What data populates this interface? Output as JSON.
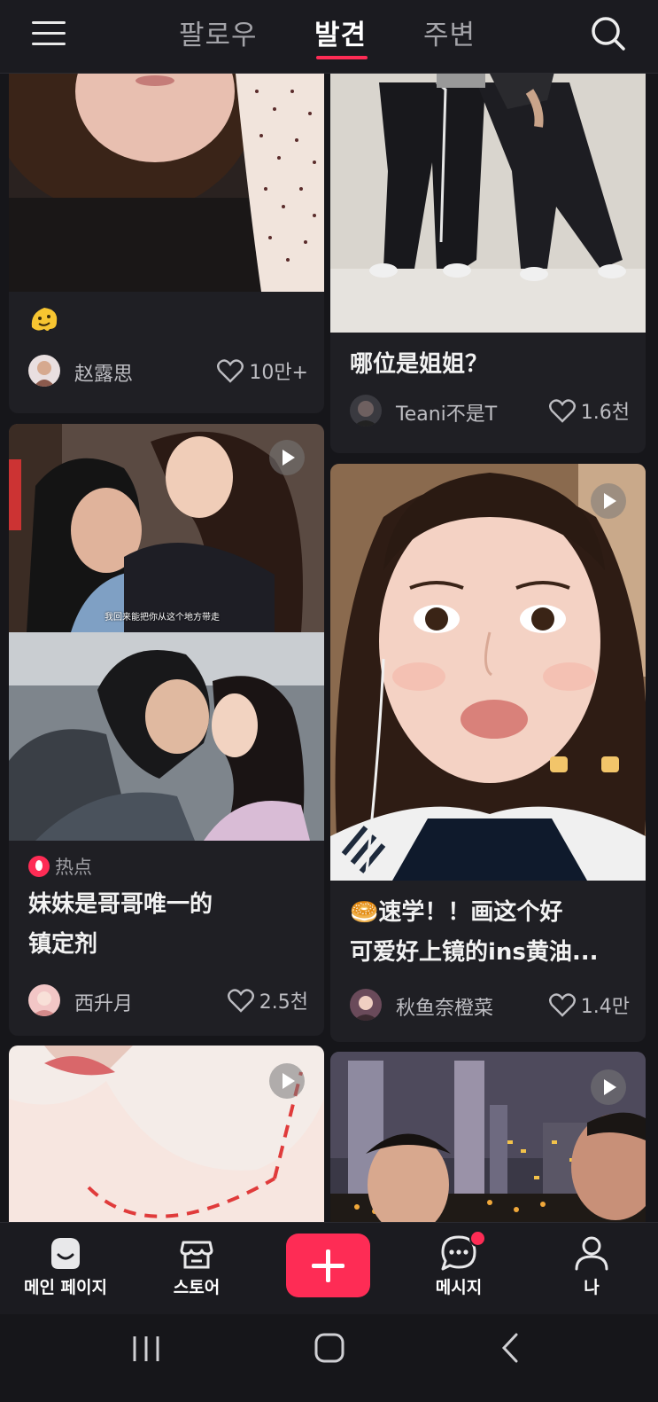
{
  "header": {
    "tabs": [
      {
        "label": "팔로우",
        "active": false
      },
      {
        "label": "발견",
        "active": true
      },
      {
        "label": "주변",
        "active": false
      }
    ],
    "accent_color": "#fe2c55"
  },
  "feed": {
    "cards": [
      {
        "id": "card-1",
        "title_emoji": "🫠",
        "author": "赵露思",
        "likes": "10만+",
        "has_video": false
      },
      {
        "id": "card-2",
        "title": "哪位是姐姐？",
        "author": "Teani不是T",
        "likes": "1.6천",
        "has_video": false
      },
      {
        "id": "card-3",
        "tag": "热点",
        "title_line1": "妹妹是哥哥唯一的",
        "title_line2": "镇定剂",
        "subtitle_overlay": "我回来能把你从这个地方带走",
        "author": "西升月",
        "likes": "2.5천",
        "has_video": true
      },
      {
        "id": "card-4",
        "title_line1": "🥯速学！！画这个好",
        "title_line2": "可爱好上镜的ins黄油...",
        "author": "秋鱼奈橙菜",
        "likes": "1.4만",
        "has_video": true
      },
      {
        "id": "card-5",
        "has_video": true
      },
      {
        "id": "card-6",
        "has_video": true
      }
    ]
  },
  "bottom_nav": {
    "items": [
      {
        "label": "메인 페이지",
        "icon": "home-icon"
      },
      {
        "label": "스토어",
        "icon": "store-icon"
      },
      {
        "label": "",
        "icon": "plus-icon"
      },
      {
        "label": "메시지",
        "icon": "message-icon",
        "badge": true
      },
      {
        "label": "나",
        "icon": "profile-icon"
      }
    ]
  }
}
